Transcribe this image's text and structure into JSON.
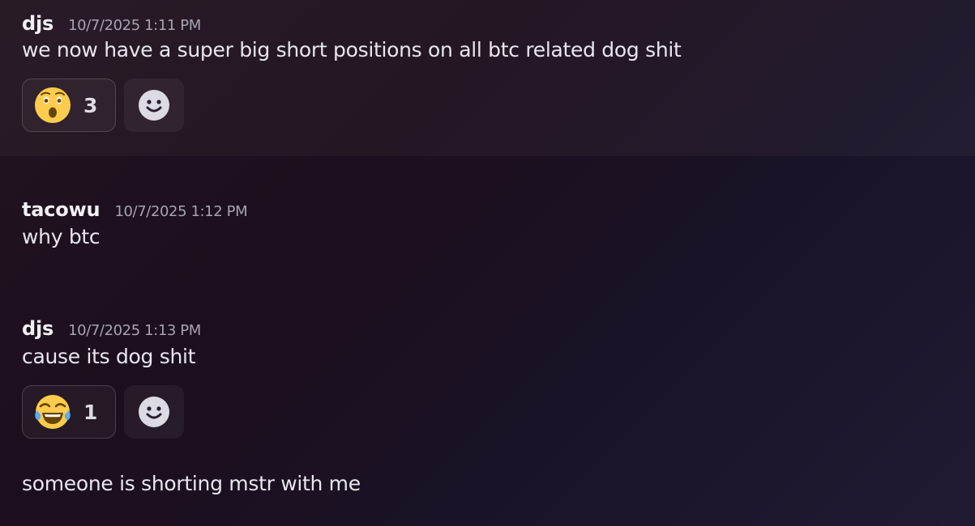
{
  "messages": [
    {
      "author": "djs",
      "timestamp": "10/7/2025 1:11 PM",
      "text": "we now have a super big short positions on all btc related dog shit",
      "reaction": {
        "emoji": "astonished-face",
        "count": "3"
      }
    },
    {
      "author": "tacowu",
      "timestamp": "10/7/2025 1:12 PM",
      "text": "why btc"
    },
    {
      "author": "djs",
      "timestamp": "10/7/2025 1:13 PM",
      "text": "cause its dog shit",
      "reaction": {
        "emoji": "face-with-tears-of-joy",
        "count": "1"
      }
    },
    {
      "text": "someone is shorting mstr with me"
    }
  ],
  "icons": {
    "add_reaction": "smile-icon"
  },
  "colors": {
    "background_start": "#22131f",
    "background_end": "#221a33",
    "author": "#f2f0f5",
    "timestamp": "#a7a3b0",
    "emoji_yellow": "#ffcc4d"
  }
}
